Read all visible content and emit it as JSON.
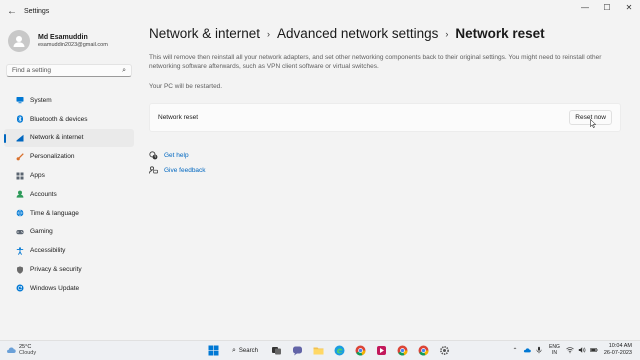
{
  "window": {
    "title": "Settings",
    "back_glyph": "←",
    "minimize_glyph": "—",
    "maximize_glyph": "☐",
    "close_glyph": "✕"
  },
  "user": {
    "name": "Md Esamuddin",
    "email": "esamuddin2023@gmail.com"
  },
  "search": {
    "placeholder": "Find a setting"
  },
  "nav": {
    "items": [
      {
        "label": "System",
        "icon": "system-icon",
        "color": "#0078d4"
      },
      {
        "label": "Bluetooth & devices",
        "icon": "bluetooth-icon",
        "color": "#0078d4"
      },
      {
        "label": "Network & internet",
        "icon": "network-icon",
        "color": "#0067c0",
        "active": true
      },
      {
        "label": "Personalization",
        "icon": "brush-icon",
        "color": "#d9702c"
      },
      {
        "label": "Apps",
        "icon": "apps-icon",
        "color": "#5a6470"
      },
      {
        "label": "Accounts",
        "icon": "accounts-icon",
        "color": "#2e9a5a"
      },
      {
        "label": "Time & language",
        "icon": "globe-icon",
        "color": "#0078d4"
      },
      {
        "label": "Gaming",
        "icon": "gaming-icon",
        "color": "#5a6470"
      },
      {
        "label": "Accessibility",
        "icon": "accessibility-icon",
        "color": "#0078d4"
      },
      {
        "label": "Privacy & security",
        "icon": "shield-icon",
        "color": "#6b6b6b"
      },
      {
        "label": "Windows Update",
        "icon": "update-icon",
        "color": "#0078d4"
      }
    ]
  },
  "breadcrumb": {
    "items": [
      "Network & internet",
      "Advanced network settings",
      "Network reset"
    ],
    "separator": "›"
  },
  "content": {
    "description": "This will remove then reinstall all your network adapters, and set other networking components back to their original settings. You might need to reinstall other networking software afterwards, such as VPN client software or virtual switches.",
    "restart_note": "Your PC will be restarted.",
    "reset_card_label": "Network reset",
    "reset_button": "Reset now"
  },
  "help": {
    "get_help": "Get help",
    "give_feedback": "Give feedback"
  },
  "taskbar": {
    "weather_temp": "25°C",
    "weather_condition": "Cloudy",
    "search_label": "Search",
    "language_line1": "ENG",
    "language_line2": "IN",
    "time": "10:04 AM",
    "date": "26-07-2023"
  },
  "colors": {
    "accent": "#0067c0",
    "link": "#0067c0"
  }
}
